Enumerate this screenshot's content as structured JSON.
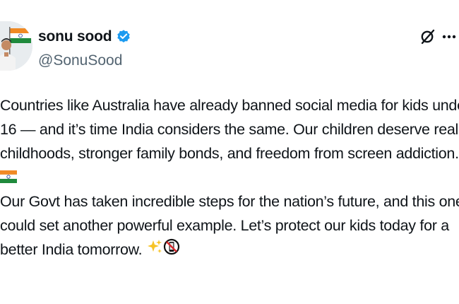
{
  "user": {
    "display_name": "sonu sood",
    "handle": "@SonuSood",
    "verified": true
  },
  "post": {
    "lines": [
      "Countries like Australia have already banned social media for kids under",
      "16 — and it’s time India considers the same. Our children deserve real",
      "childhoods, stronger family bonds, and freedom from screen addiction."
    ],
    "flag_emoji": "india-flag-icon",
    "lines2": [
      "Our Govt has taken incredible steps for the nation’s future, and this one",
      "could set another powerful example. Let’s protect our kids today for a",
      "better India tomorrow."
    ],
    "trailing_emojis": [
      "sparkles-icon",
      "no-mobile-phones-icon"
    ]
  },
  "actions": {
    "grok_icon": "grok-icon",
    "more_icon": "more-options-icon"
  },
  "colors": {
    "text": "#0f1419",
    "secondary_text": "#536471",
    "verified_blue": "#1d9bf0"
  }
}
